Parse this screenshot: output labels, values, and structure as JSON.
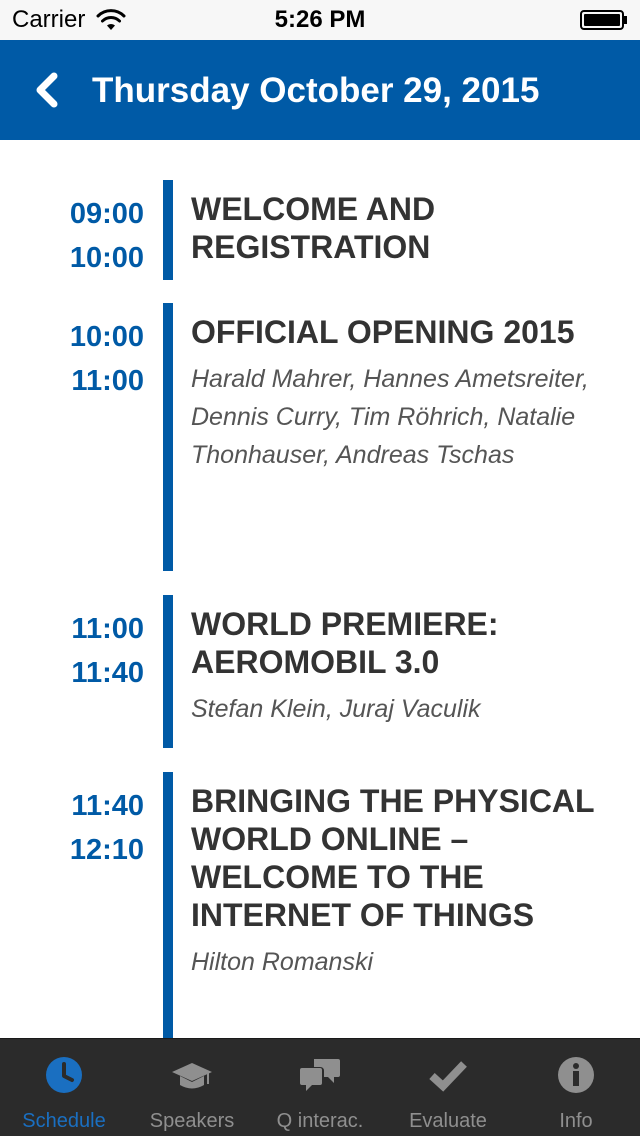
{
  "status_bar": {
    "carrier": "Carrier",
    "time": "5:26 PM"
  },
  "nav": {
    "title": "Thursday October 29, 2015",
    "back_icon": "chevron-left-icon"
  },
  "sessions": [
    {
      "start": "09:00",
      "end": "10:00",
      "title": "WELCOME AND REGISTRATION",
      "speakers": ""
    },
    {
      "start": "10:00",
      "end": "11:00",
      "title": "OFFICIAL OPENING 2015",
      "speakers": "Harald Mahrer, Hannes Ametsreiter, Dennis Curry, Tim Röhrich, Natalie Thonhauser, Andreas Tschas"
    },
    {
      "start": "11:00",
      "end": "11:40",
      "title": "WORLD PREMIERE: AEROMOBIL 3.0",
      "speakers": "Stefan Klein, Juraj Vaculik"
    },
    {
      "start": "11:40",
      "end": "12:10",
      "title": "BRINGING THE PHYSICAL WORLD ONLINE – WELCOME TO THE INTERNET OF THINGS",
      "speakers": "Hilton Romanski"
    }
  ],
  "tabs": [
    {
      "label": "Schedule",
      "icon": "clock-icon",
      "active": true
    },
    {
      "label": "Speakers",
      "icon": "graduation-cap-icon",
      "active": false
    },
    {
      "label": "Q interac.",
      "icon": "chat-bubbles-icon",
      "active": false
    },
    {
      "label": "Evaluate",
      "icon": "checkmark-icon",
      "active": false
    },
    {
      "label": "Info",
      "icon": "info-icon",
      "active": false
    }
  ],
  "colors": {
    "brand_blue": "#005aa6",
    "tab_active": "#1a6fc1",
    "tab_inactive": "#8f8f8f",
    "tab_bar_bg": "#2b2b2b"
  }
}
